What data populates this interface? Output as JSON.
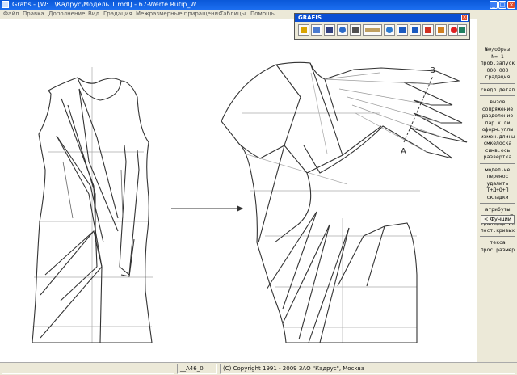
{
  "window": {
    "title": "Grafis - [W: ..\\Кадрус\\Модель 1.mdl] - 67-Werte Rutip_W",
    "minimize": "_",
    "maximize": "□",
    "close": "×"
  },
  "menu": [
    "Файл",
    "Правка",
    "Дополнение",
    "Вид",
    "Градация",
    "Межразмерные приращения",
    "Таблицы",
    "Помощь"
  ],
  "grafis_toolbar": {
    "title": "GRAFIS",
    "close": "×",
    "buttons": [
      {
        "icon": "open-folder-icon",
        "color": "#d9a400"
      },
      {
        "icon": "edit-folder-icon",
        "color": "#4a7bd0"
      },
      {
        "icon": "save-disk-icon",
        "color": "#304080"
      },
      {
        "icon": "search-icon",
        "color": "#2a6ac8"
      },
      {
        "icon": "layers-icon",
        "color": "#505050"
      },
      {
        "icon": "ruler-icon",
        "color": "#c0a060"
      },
      {
        "icon": "globe-icon",
        "color": "#2a7ad0"
      },
      {
        "icon": "grading-x-icon",
        "color": "#1a5ac0"
      },
      {
        "icon": "grading-z-icon",
        "color": "#1a5ac0"
      },
      {
        "icon": "arrow-down-icon",
        "color": "#d03020"
      },
      {
        "icon": "arrow-down-alt-icon",
        "color": "#d08020"
      },
      {
        "icon": "stop-icon",
        "color": "#e02020"
      },
      {
        "icon": "exit-icon",
        "color": "#208060"
      }
    ]
  },
  "right_panel": {
    "lines": [
      {
        "text": "№Ф/образ"
      },
      {
        "text": "N=  1"
      },
      {
        "text": "проб.запуск"
      },
      {
        "text": "000 000"
      },
      {
        "text": "градация"
      },
      {
        "text": "",
        "sep": true
      },
      {
        "text": "сведл.детал"
      },
      {
        "text": "",
        "sep": true
      },
      {
        "text": "вызов"
      },
      {
        "text": "сопряжение"
      },
      {
        "text": "разделение"
      },
      {
        "text": "пар.к.ли"
      },
      {
        "text": "оформ.углы"
      },
      {
        "text": "измен.длины"
      },
      {
        "text": "смкелоска"
      },
      {
        "text": "симв.ось"
      },
      {
        "text": "развертка"
      },
      {
        "text": "",
        "sep": true
      },
      {
        "text": "модел-ие"
      },
      {
        "text": "перенос"
      },
      {
        "text": "удалить"
      },
      {
        "text": "Т+Д+О+П"
      },
      {
        "text": "складки"
      },
      {
        "text": "",
        "sep": true
      },
      {
        "text": "атрибуты"
      },
      {
        "text": "редактор Т"
      },
      {
        "text": "трансфор-ия"
      },
      {
        "text": "пост.кривых"
      },
      {
        "text": "",
        "sep": true
      },
      {
        "text": "текса"
      },
      {
        "text": "прос.размер"
      }
    ],
    "functions_button": "< Фунции"
  },
  "status_bar": {
    "cell_left": "",
    "code": "__A46_0",
    "copyright": "(C) Copyright 1991 - 2009 ЗАО \"Кадрус\", Москва"
  },
  "drawing": {
    "point_a": "A",
    "point_b": "B"
  }
}
